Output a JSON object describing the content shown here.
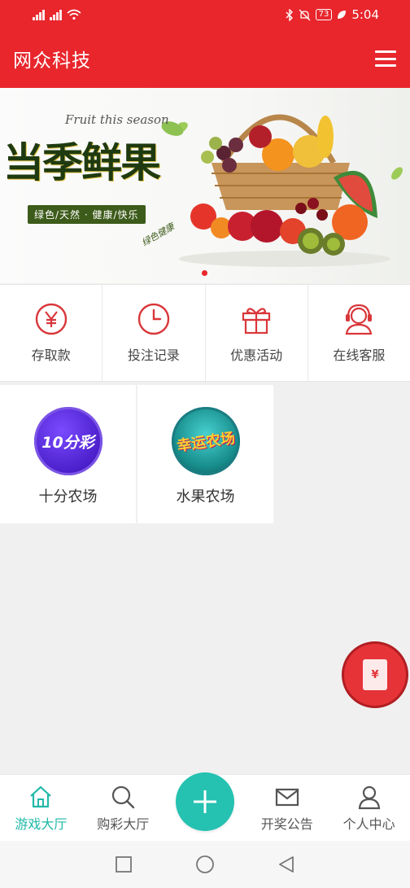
{
  "status_bar": {
    "left_icons": [
      "signal-icon",
      "signal-icon",
      "wifi-icon"
    ],
    "right_icons": [
      "bluetooth-icon",
      "mute-icon",
      "battery-icon",
      "leaf-icon"
    ],
    "battery": "73",
    "time": "5:04"
  },
  "header": {
    "title": "网众科技",
    "menu_icon": "hamburger-icon"
  },
  "banner": {
    "english_text": "Fruit this season",
    "title": "当季鲜果",
    "pill_text": "绿色/天然 · 健康/快乐",
    "stamp_text": "绿色健康",
    "slide_count": 1,
    "active_slide": 1
  },
  "quick_menu": [
    {
      "label": "存取款",
      "icon": "yen-icon"
    },
    {
      "label": "投注记录",
      "icon": "clock-icon"
    },
    {
      "label": "优惠活动",
      "icon": "gift-icon"
    },
    {
      "label": "在线客服",
      "icon": "headset-icon"
    }
  ],
  "games": [
    {
      "label": "十分农场",
      "logo_text": "10分彩"
    },
    {
      "label": "水果农场",
      "logo_text": "幸运农场"
    }
  ],
  "float_button": {
    "icon": "red-envelope-icon",
    "glyph": "¥"
  },
  "tab_bar": {
    "tabs": [
      {
        "label": "游戏大厅",
        "icon": "home-icon",
        "active": true
      },
      {
        "label": "购彩大厅",
        "icon": "search-icon",
        "active": false
      },
      {
        "label": "开奖公告",
        "icon": "mail-icon",
        "active": false
      },
      {
        "label": "个人中心",
        "icon": "user-icon",
        "active": false
      }
    ],
    "center_icon": "plus-icon"
  },
  "colors": {
    "brand_red": "#e8262c",
    "accent_teal": "#25c1b1",
    "active_tab": "#1fb8a8"
  }
}
